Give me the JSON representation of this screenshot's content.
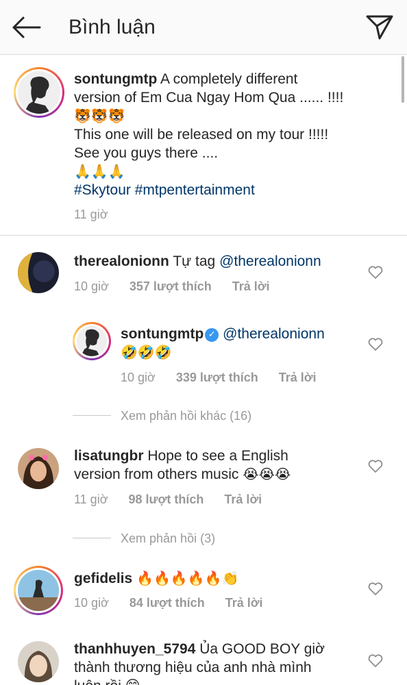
{
  "header": {
    "title": "Bình luận"
  },
  "caption": {
    "username": "sontungmtp",
    "line1": "A completely different",
    "line2": "version of Em Cua Ngay Hom Qua ...... !!!!",
    "emoji_line1": "🐯🐯🐯",
    "line3": "This one will be released on my tour !!!!!",
    "line4": "See you guys there ....",
    "emoji_line2": "🙏🙏🙏",
    "hashtags": "#Skytour #mtpentertainment",
    "time": "11 giờ"
  },
  "comments": [
    {
      "username": "therealonionn",
      "text": "Tự tag",
      "mention": "@therealonionn",
      "time": "10 giờ",
      "likes": "357 lượt thích",
      "reply": "Trả lời"
    },
    {
      "username": "sontungmtp",
      "verified_icon": "✓",
      "mention": "@therealonionn",
      "emojis": "🤣🤣🤣",
      "time": "10 giờ",
      "likes": "339 lượt thích",
      "reply": "Trả lời"
    },
    {
      "more_replies": "Xem phản hồi khác (16)"
    },
    {
      "username": "lisatungbr",
      "line1": "Hope to see a English",
      "line2": "version from others music",
      "emojis": "😭😭😭",
      "time": "11 giờ",
      "likes": "98 lượt thích",
      "reply": "Trả lời"
    },
    {
      "more_replies": "Xem phản hồi (3)"
    },
    {
      "username": "gefidelis",
      "emojis": "🔥🔥🔥🔥🔥👏",
      "time": "10 giờ",
      "likes": "84 lượt thích",
      "reply": "Trả lời"
    },
    {
      "username": "thanhhuyen_5794",
      "line1": "Ủa GOOD BOY giờ",
      "line2": "thành thương hiệu của anh nhà mình",
      "line3": "luôn rồi 😊"
    }
  ],
  "icons": [
    "back-arrow-icon",
    "send-icon",
    "heart-icon",
    "verified-badge-icon"
  ],
  "colors": {
    "link": "#003569",
    "muted": "#999999",
    "verified": "#3897f0",
    "header_bg": "#fafafa"
  }
}
